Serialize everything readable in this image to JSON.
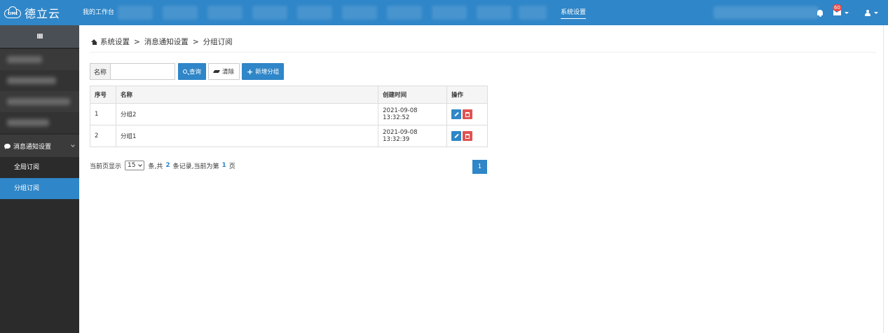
{
  "header": {
    "logo_text": "德立云",
    "logo_badge": "CIMC",
    "nav": [
      {
        "label": "我的工作台"
      },
      {
        "label": "系统设置"
      }
    ],
    "mail_badge": "60"
  },
  "sidebar": {
    "toggle": "III",
    "section": "消息通知设置",
    "items": [
      {
        "label": "全局订阅"
      },
      {
        "label": "分组订阅"
      }
    ]
  },
  "breadcrumb": {
    "items": [
      "系统设置",
      "消息通知设置",
      "分组订阅"
    ],
    "sep": ">"
  },
  "search": {
    "name_label": "名称",
    "name_value": "",
    "query_btn": "查询",
    "clear_btn": "清除",
    "add_btn": "新增分组"
  },
  "table": {
    "headers": [
      "序号",
      "名称",
      "创建时间",
      "操作"
    ],
    "rows": [
      {
        "no": "1",
        "name": "分组2",
        "created": "2021-09-08 13:32:52"
      },
      {
        "no": "2",
        "name": "分组1",
        "created": "2021-09-08 13:32:39"
      }
    ]
  },
  "pager": {
    "prefix": "当前页显示",
    "page_size": "15",
    "mid": "条,共",
    "total": "2",
    "mid2": "条记录,当前为第",
    "current": "1",
    "suffix": "页",
    "page_button": "1"
  },
  "colors": {
    "brand": "#2f86c8",
    "danger": "#e05252",
    "sidebar": "#2b2b2b"
  }
}
